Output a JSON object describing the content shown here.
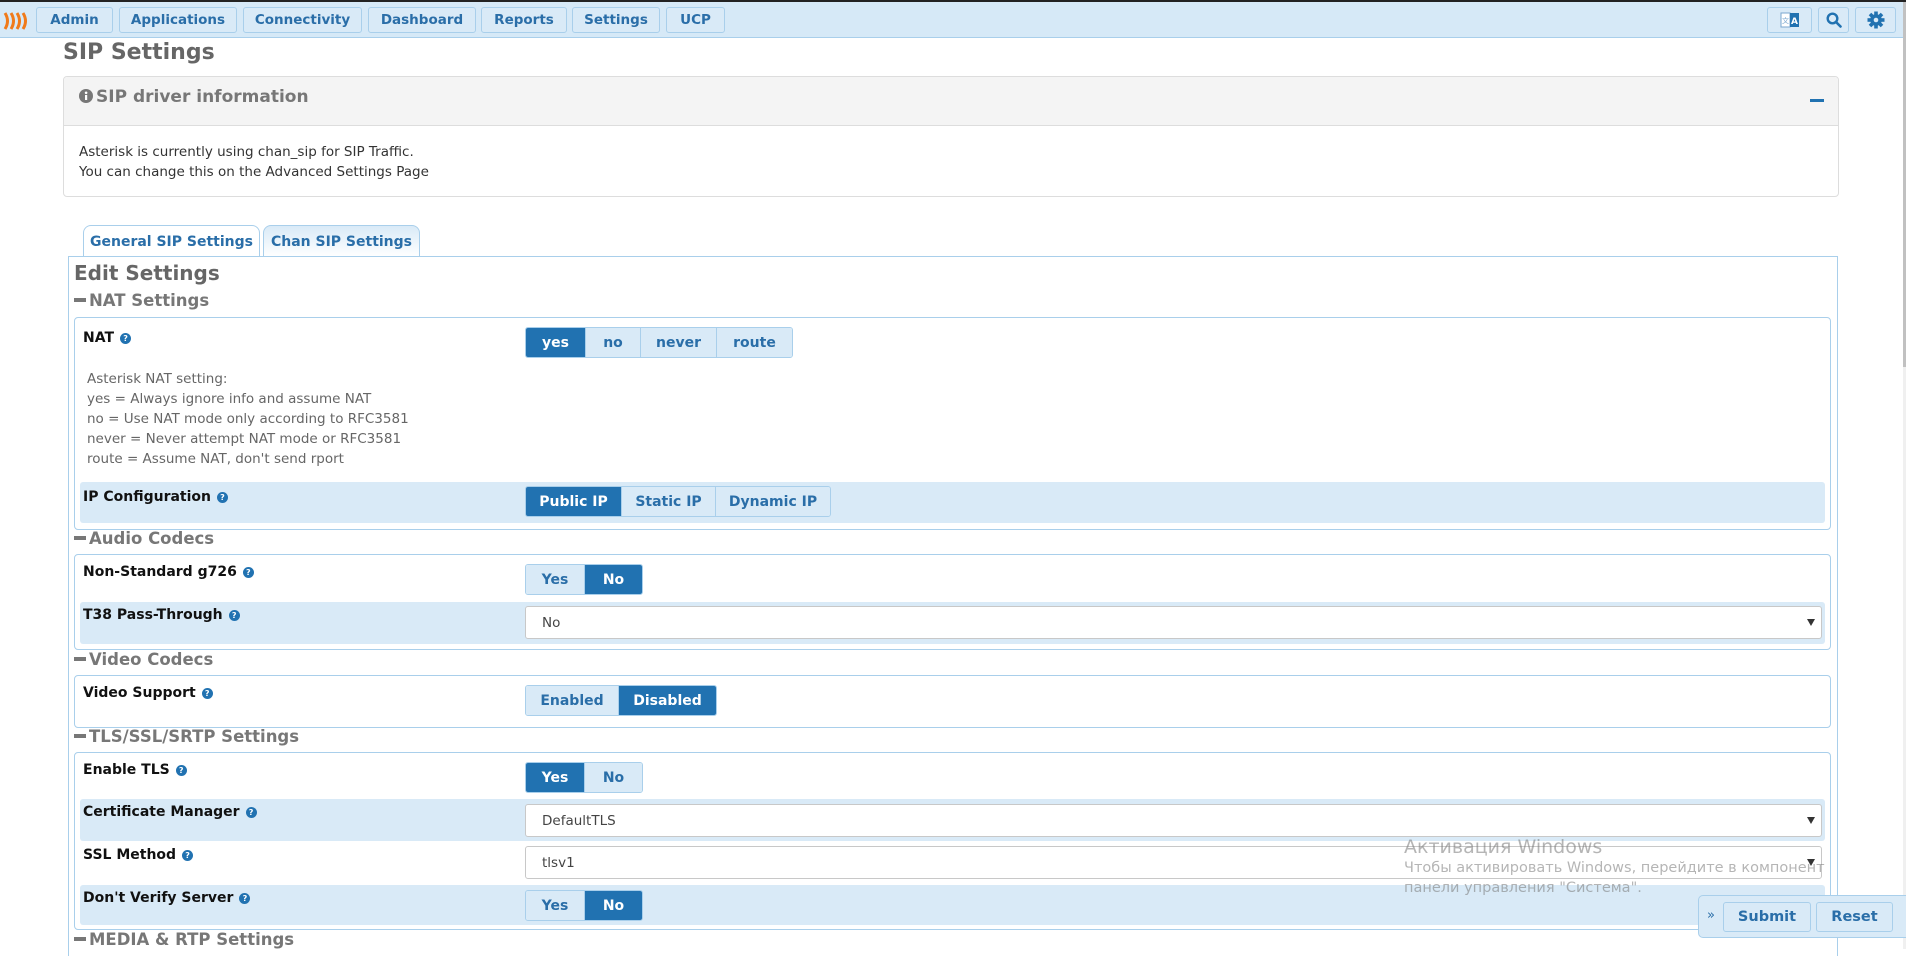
{
  "navbar": {
    "menu": [
      "Admin",
      "Applications",
      "Connectivity",
      "Dashboard",
      "Reports",
      "Settings",
      "UCP"
    ],
    "right_icons": [
      "language-icon",
      "search-icon",
      "gear-icon"
    ]
  },
  "page": {
    "title": "SIP Settings"
  },
  "info_panel": {
    "title": "SIP driver information",
    "icon": "info-icon",
    "lines": [
      "Asterisk is currently using chan_sip for SIP Traffic.",
      "You can change this on the Advanced Settings Page"
    ]
  },
  "tabs": [
    {
      "label": "General SIP Settings",
      "active": false
    },
    {
      "label": "Chan SIP Settings",
      "active": true
    }
  ],
  "edit_title": "Edit Settings",
  "sections": {
    "nat": {
      "title": "NAT Settings",
      "nat_label": "NAT",
      "nat_options": [
        "yes",
        "no",
        "never",
        "route"
      ],
      "nat_selected": "yes",
      "nat_help": [
        "Asterisk NAT setting:",
        "yes = Always ignore info and assume NAT",
        "no = Use NAT mode only according to RFC3581",
        "never = Never attempt NAT mode or RFC3581",
        "route = Assume NAT, don't send rport"
      ],
      "ip_label": "IP Configuration",
      "ip_options": [
        "Public IP",
        "Static IP",
        "Dynamic IP"
      ],
      "ip_selected": "Public IP"
    },
    "audio": {
      "title": "Audio Codecs",
      "g726_label": "Non-Standard g726",
      "g726_options": [
        "Yes",
        "No"
      ],
      "g726_selected": "No",
      "t38_label": "T38 Pass-Through",
      "t38_value": "No"
    },
    "video": {
      "title": "Video Codecs",
      "support_label": "Video Support",
      "support_options": [
        "Enabled",
        "Disabled"
      ],
      "support_selected": "Disabled"
    },
    "tls": {
      "title": "TLS/SSL/SRTP Settings",
      "enable_label": "Enable TLS",
      "enable_options": [
        "Yes",
        "No"
      ],
      "enable_selected": "Yes",
      "cert_label": "Certificate Manager",
      "cert_value": "DefaultTLS",
      "ssl_label": "SSL Method",
      "ssl_value": "tlsv1",
      "verify_label": "Don't Verify Server",
      "verify_options": [
        "Yes",
        "No"
      ],
      "verify_selected": "No"
    },
    "media": {
      "title": "MEDIA & RTP Settings"
    }
  },
  "watermark": {
    "title": "Активация Windows",
    "text": "Чтобы активировать Windows, перейдите в компонент панели управления \"Система\"."
  },
  "actions": {
    "expand": "»",
    "submit": "Submit",
    "reset": "Reset"
  },
  "help_glyph": "?"
}
